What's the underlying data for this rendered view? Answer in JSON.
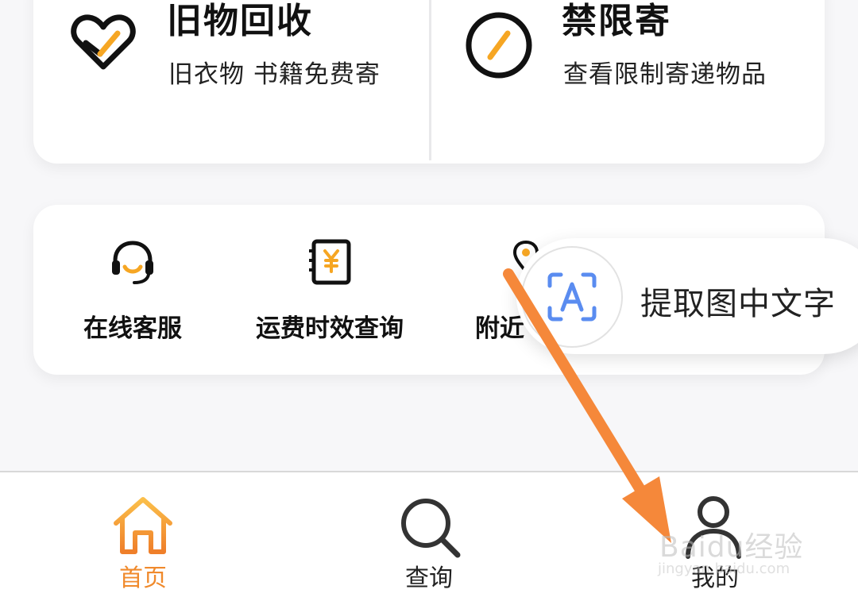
{
  "services": [
    {
      "title": "旧物回收",
      "subtitle": "旧衣物 书籍免费寄",
      "icon": "heart-icon"
    },
    {
      "title": "禁限寄",
      "subtitle": "查看限制寄递物品",
      "icon": "prohibited-icon"
    }
  ],
  "tools": [
    {
      "label": "在线客服",
      "icon": "headset-icon"
    },
    {
      "label": "运费时效查询",
      "icon": "fee-notebook-icon"
    },
    {
      "label": "附近",
      "icon": "location-icon"
    }
  ],
  "ocr_popup": {
    "label": "提取图中文字",
    "icon": "text-recognition-icon"
  },
  "bottom_nav": [
    {
      "label": "首页",
      "icon": "home-icon",
      "active": true
    },
    {
      "label": "查询",
      "icon": "search-icon",
      "active": false
    },
    {
      "label": "我的",
      "icon": "profile-icon",
      "active": false
    }
  ],
  "annotation": {
    "color": "#f5883a",
    "icon": "arrow-annotation"
  },
  "watermark": {
    "brand": "Baidu经验",
    "url": "jingyan.baidu.com"
  },
  "colors": {
    "accent": "#f6a623",
    "nav_active": "#f08a2c",
    "ocr_blue": "#5a8cf0"
  }
}
